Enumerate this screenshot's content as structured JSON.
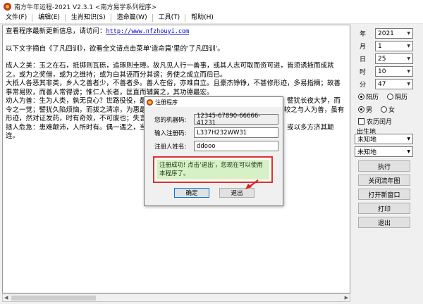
{
  "window": {
    "title": "南方牛年运程-2021  V2.3.1  <南方易学系列程序>"
  },
  "menu": [
    "文件(F)",
    "编辑(E)",
    "生肖知识(S)",
    "造命篇(W)",
    "工具(T)",
    "帮助(H)"
  ],
  "content": {
    "line1_prefix": "查看程序最新更新信息，请访问：",
    "line1_link": "http://www.nfzhouyi.com",
    "line2": "以下文字摘自《了凡四训》，欲看全文请点击菜单'造命篇'里的'了凡四训'。",
    "paragraphs": [
      "成人之美：玉之在石，抵掷则瓦砾，追琢则圭璋。故凡见人行一善事，或其人志可取而资可进，皆须诱掖而成就之。或为之奖借，或为之维持；或为白其诬而分其谤；务使之成立而后已。",
      "大抵人各恶其非类，乡人之善者少，不善者多。善人在俗，亦难自立。且豪杰铮铮，不甚修形迹，多易指摘；故善事常易败，而善人常得谤；惟仁人长者，匡直而辅翼之，其功德最宏。",
      "劝人为善：生为人类，孰无良心？世路役役，最易没溺。凡与人相处，当方便提撕，开其迷惑。譬犹长夜大梦，而令之一觉；譬犹久陷烦恼，而拔之清凉，为惠最溥。韩愈云：'一时劝人以口，百世劝人以书。'较之与人为善，虽有形迹，然对证发药，时有奇效，不可废也；失言失人，当反吾智。",
      "拯人危急：患难颠沛，人所时有。偶一遇之，当如恫瘝之在身，速为解救。或以一言伸其屈抑；或以多方济其颠连。"
    ]
  },
  "panel": {
    "fields": [
      {
        "label": "年",
        "value": "2021"
      },
      {
        "label": "月",
        "value": "1"
      },
      {
        "label": "日",
        "value": "25"
      },
      {
        "label": "时",
        "value": "10"
      },
      {
        "label": "分",
        "value": "47"
      }
    ],
    "calendar_options": [
      "阳历",
      "阴历"
    ],
    "gender_options": [
      "男",
      "女"
    ],
    "leap_month_label": "农历闰月",
    "birthplace_label": "出生地",
    "birthplace_province": "未知地",
    "birthplace_city": "未知地",
    "buttons": [
      "执行",
      "关闭流年图",
      "打开新窗口",
      "打印",
      "退出"
    ]
  },
  "dialog": {
    "title": "注册程序",
    "machine_code_label": "您的机器码:",
    "machine_code": "12345-67890-66666-41231",
    "reg_code_label": "输入注册码:",
    "reg_code": "L337H232WW31",
    "name_label": "注册人姓名:",
    "name": "ddooo",
    "message": "注册成功! 点击'退出'，您现在可以使用本程序了。",
    "ok_button": "确定",
    "exit_button": "退出"
  }
}
